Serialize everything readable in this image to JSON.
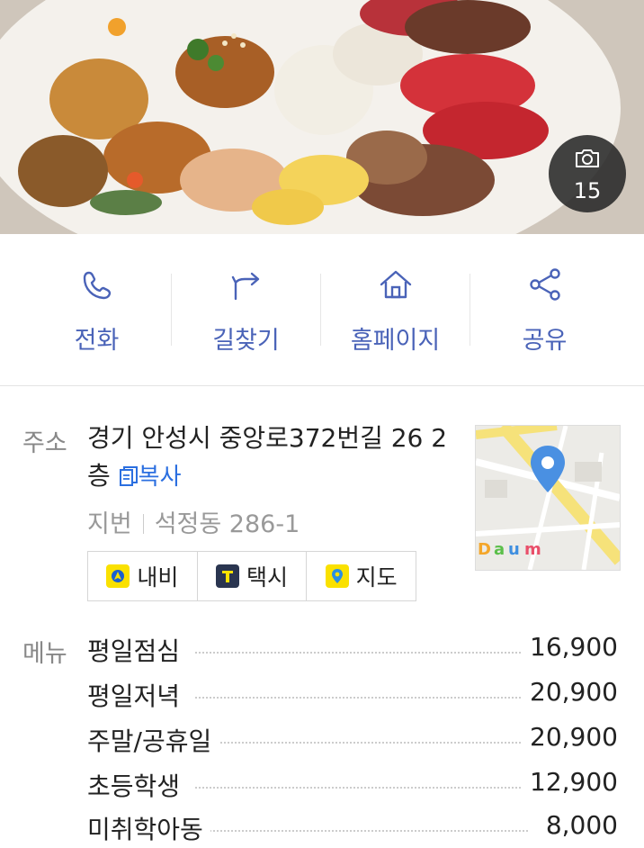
{
  "photo": {
    "count": "15"
  },
  "actions": [
    {
      "label": "전화",
      "icon": "phone-icon"
    },
    {
      "label": "길찾기",
      "icon": "directions-icon"
    },
    {
      "label": "홈페이지",
      "icon": "home-icon"
    },
    {
      "label": "공유",
      "icon": "share-icon"
    }
  ],
  "info": {
    "address_label": "주소",
    "address": "경기 안성시 중앙로372번길 26 2층",
    "copy_label": "복사",
    "jibun_label": "지번",
    "jibun_value": "석정동 286-1",
    "buttons": {
      "navi": "내비",
      "taxi": "택시",
      "map": "지도"
    }
  },
  "menu": {
    "label": "메뉴",
    "items": [
      {
        "name": "평일점심",
        "price": "16,900"
      },
      {
        "name": "평일저녁",
        "price": "20,900"
      },
      {
        "name": "주말/공휴일",
        "price": "20,900"
      },
      {
        "name": "초등학생",
        "price": "12,900"
      },
      {
        "name": "미취학아동",
        "price": "8,000"
      }
    ]
  },
  "colors": {
    "accent": "#4a63b8",
    "link": "#2b6fe0",
    "kakao_yellow": "#fae100",
    "map_pin": "#4a90e2"
  }
}
